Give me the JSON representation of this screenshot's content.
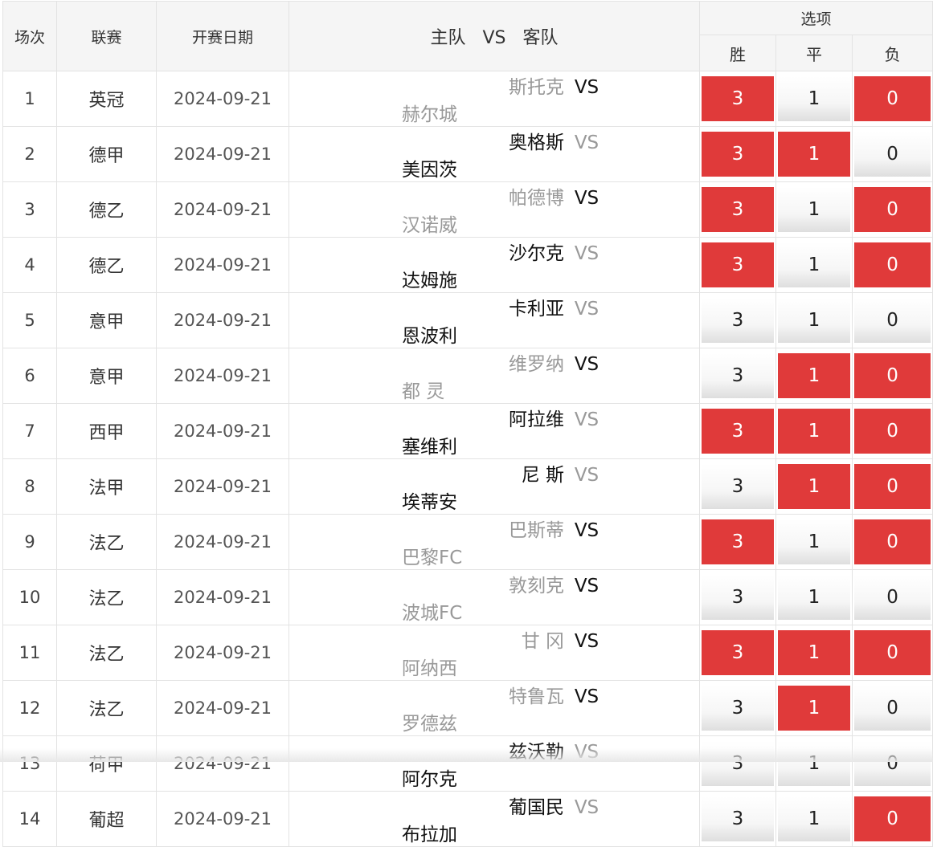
{
  "header": {
    "col_index": "场次",
    "col_league": "联赛",
    "col_date": "开赛日期",
    "col_match_home": "主队",
    "col_match_vs": "VS",
    "col_match_away": "客队",
    "col_options": "选项",
    "opt_win": "胜",
    "opt_draw": "平",
    "opt_lose": "负"
  },
  "colors": {
    "selected": "#e03a3a",
    "team_dark": "#111111",
    "team_grey": "#999999"
  },
  "rows": [
    {
      "no": "1",
      "league": "英冠",
      "date": "2024-09-21",
      "home": "斯托克",
      "vs": "VS",
      "away": "赫尔城",
      "vs_emph": true,
      "win": "3",
      "draw": "1",
      "lose": "0",
      "sel": [
        true,
        false,
        true
      ]
    },
    {
      "no": "2",
      "league": "德甲",
      "date": "2024-09-21",
      "home": "奥格斯",
      "vs": "VS",
      "away": "美因茨",
      "vs_emph": false,
      "win": "3",
      "draw": "1",
      "lose": "0",
      "sel": [
        true,
        true,
        false
      ]
    },
    {
      "no": "3",
      "league": "德乙",
      "date": "2024-09-21",
      "home": "帕德博",
      "vs": "VS",
      "away": "汉诺威",
      "vs_emph": true,
      "win": "3",
      "draw": "1",
      "lose": "0",
      "sel": [
        true,
        false,
        true
      ]
    },
    {
      "no": "4",
      "league": "德乙",
      "date": "2024-09-21",
      "home": "沙尔克",
      "vs": "VS",
      "away": "达姆施",
      "vs_emph": false,
      "win": "3",
      "draw": "1",
      "lose": "0",
      "sel": [
        true,
        false,
        true
      ]
    },
    {
      "no": "5",
      "league": "意甲",
      "date": "2024-09-21",
      "home": "卡利亚",
      "vs": "VS",
      "away": "恩波利",
      "vs_emph": false,
      "win": "3",
      "draw": "1",
      "lose": "0",
      "sel": [
        false,
        false,
        false
      ]
    },
    {
      "no": "6",
      "league": "意甲",
      "date": "2024-09-21",
      "home": "维罗纳",
      "vs": "VS",
      "away": "都 灵",
      "vs_emph": true,
      "win": "3",
      "draw": "1",
      "lose": "0",
      "sel": [
        false,
        true,
        true
      ]
    },
    {
      "no": "7",
      "league": "西甲",
      "date": "2024-09-21",
      "home": "阿拉维",
      "vs": "VS",
      "away": "塞维利",
      "vs_emph": false,
      "win": "3",
      "draw": "1",
      "lose": "0",
      "sel": [
        true,
        true,
        true
      ]
    },
    {
      "no": "8",
      "league": "法甲",
      "date": "2024-09-21",
      "home": "尼 斯",
      "vs": "VS",
      "away": "埃蒂安",
      "vs_emph": false,
      "win": "3",
      "draw": "1",
      "lose": "0",
      "sel": [
        false,
        true,
        true
      ]
    },
    {
      "no": "9",
      "league": "法乙",
      "date": "2024-09-21",
      "home": "巴斯蒂",
      "vs": "VS",
      "away": "巴黎FC",
      "vs_emph": true,
      "win": "3",
      "draw": "1",
      "lose": "0",
      "sel": [
        true,
        false,
        true
      ]
    },
    {
      "no": "10",
      "league": "法乙",
      "date": "2024-09-21",
      "home": "敦刻克",
      "vs": "VS",
      "away": "波城FC",
      "vs_emph": true,
      "win": "3",
      "draw": "1",
      "lose": "0",
      "sel": [
        false,
        false,
        false
      ]
    },
    {
      "no": "11",
      "league": "法乙",
      "date": "2024-09-21",
      "home": "甘 冈",
      "vs": "VS",
      "away": "阿纳西",
      "vs_emph": true,
      "win": "3",
      "draw": "1",
      "lose": "0",
      "sel": [
        true,
        true,
        true
      ]
    },
    {
      "no": "12",
      "league": "法乙",
      "date": "2024-09-21",
      "home": "特鲁瓦",
      "vs": "VS",
      "away": "罗德兹",
      "vs_emph": true,
      "win": "3",
      "draw": "1",
      "lose": "0",
      "sel": [
        false,
        true,
        false
      ]
    },
    {
      "no": "13",
      "league": "荷甲",
      "date": "2024-09-21",
      "home": "兹沃勒",
      "vs": "VS",
      "away": "阿尔克",
      "vs_emph": false,
      "win": "3",
      "draw": "1",
      "lose": "0",
      "sel": [
        false,
        false,
        false
      ]
    },
    {
      "no": "14",
      "league": "葡超",
      "date": "2024-09-21",
      "home": "葡国民",
      "vs": "VS",
      "away": "布拉加",
      "vs_emph": false,
      "win": "3",
      "draw": "1",
      "lose": "0",
      "sel": [
        false,
        false,
        true
      ]
    }
  ]
}
